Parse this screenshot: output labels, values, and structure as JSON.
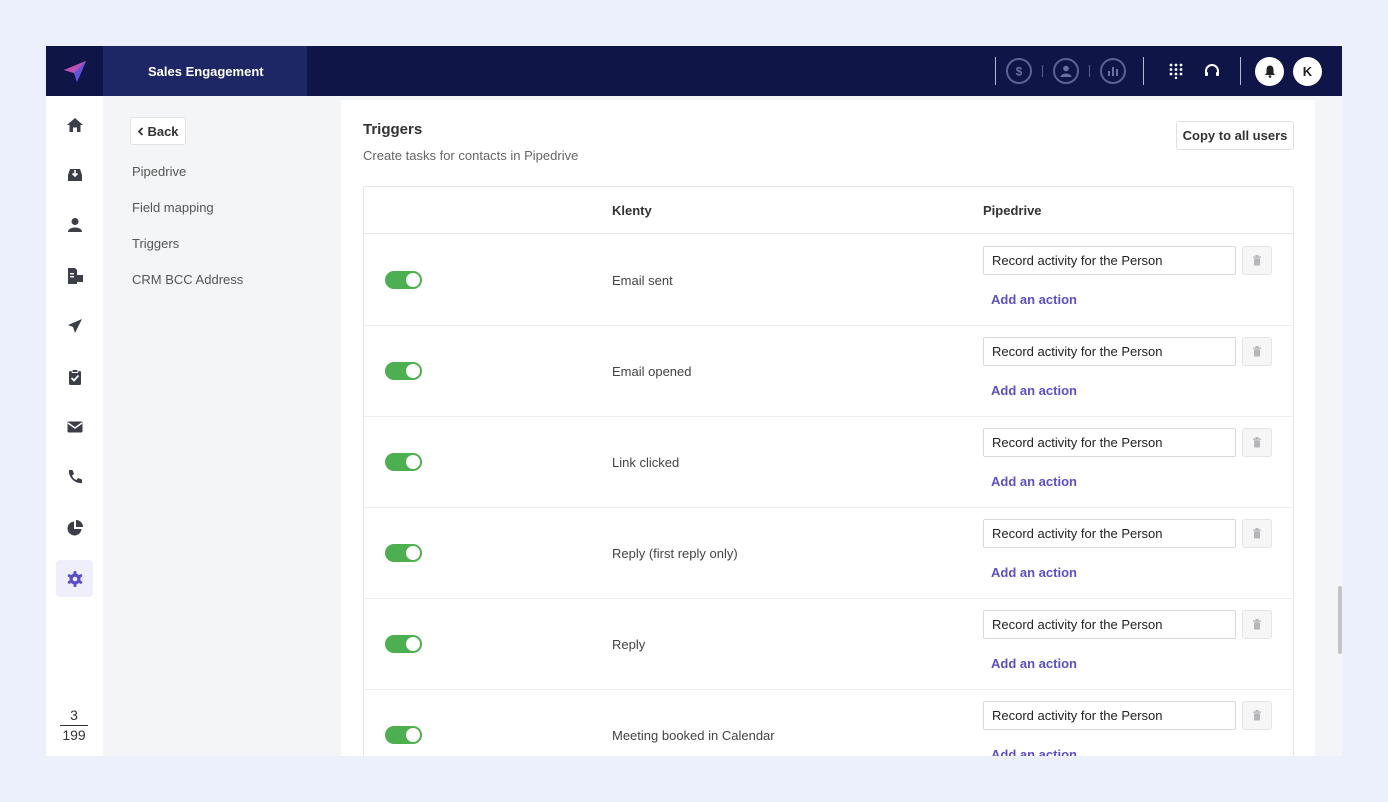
{
  "topbar": {
    "product": "Sales Engagement",
    "user_initial": "K",
    "icons": [
      "dollar-icon",
      "person-icon",
      "bar-chart-icon",
      "dialpad-icon",
      "headset-icon",
      "bell-icon"
    ]
  },
  "leftnav": {
    "icons": [
      "home-icon",
      "inbox-icon",
      "contact-icon",
      "documents-icon",
      "send-icon",
      "tasks-icon",
      "mail-icon",
      "phone-icon",
      "pie-chart-icon",
      "settings-icon"
    ],
    "active": "settings-icon",
    "pager": {
      "current": "3",
      "total": "199"
    }
  },
  "submenu": {
    "back_label": "Back",
    "items": [
      {
        "label": "Pipedrive"
      },
      {
        "label": "Field mapping"
      },
      {
        "label": "Triggers"
      },
      {
        "label": "CRM BCC Address"
      }
    ]
  },
  "main": {
    "title": "Triggers",
    "subtitle": "Create tasks for contacts in Pipedrive",
    "copy_button": "Copy to all users",
    "columns": {
      "klenty": "Klenty",
      "pipedrive": "Pipedrive"
    },
    "rows": [
      {
        "trigger": "Email sent",
        "enabled": true,
        "action": "Record activity for the Person",
        "add_label": "Add an action"
      },
      {
        "trigger": "Email opened",
        "enabled": true,
        "action": "Record activity for the Person",
        "add_label": "Add an action"
      },
      {
        "trigger": "Link clicked",
        "enabled": true,
        "action": "Record activity for the Person",
        "add_label": "Add an action"
      },
      {
        "trigger": "Reply (first reply only)",
        "enabled": true,
        "action": "Record activity for the Person",
        "add_label": "Add an action"
      },
      {
        "trigger": "Reply",
        "enabled": true,
        "action": "Record activity for the Person",
        "add_label": "Add an action"
      },
      {
        "trigger": "Meeting booked in Calendar",
        "enabled": true,
        "action": "Record activity for the Person",
        "add_label": "Add an action"
      }
    ]
  },
  "colors": {
    "topbar": "#0f1546",
    "product_tab": "#1e2766",
    "toggle_on": "#4caf50",
    "link": "#5b4fc9",
    "settings_active": "#5b4fc9"
  }
}
